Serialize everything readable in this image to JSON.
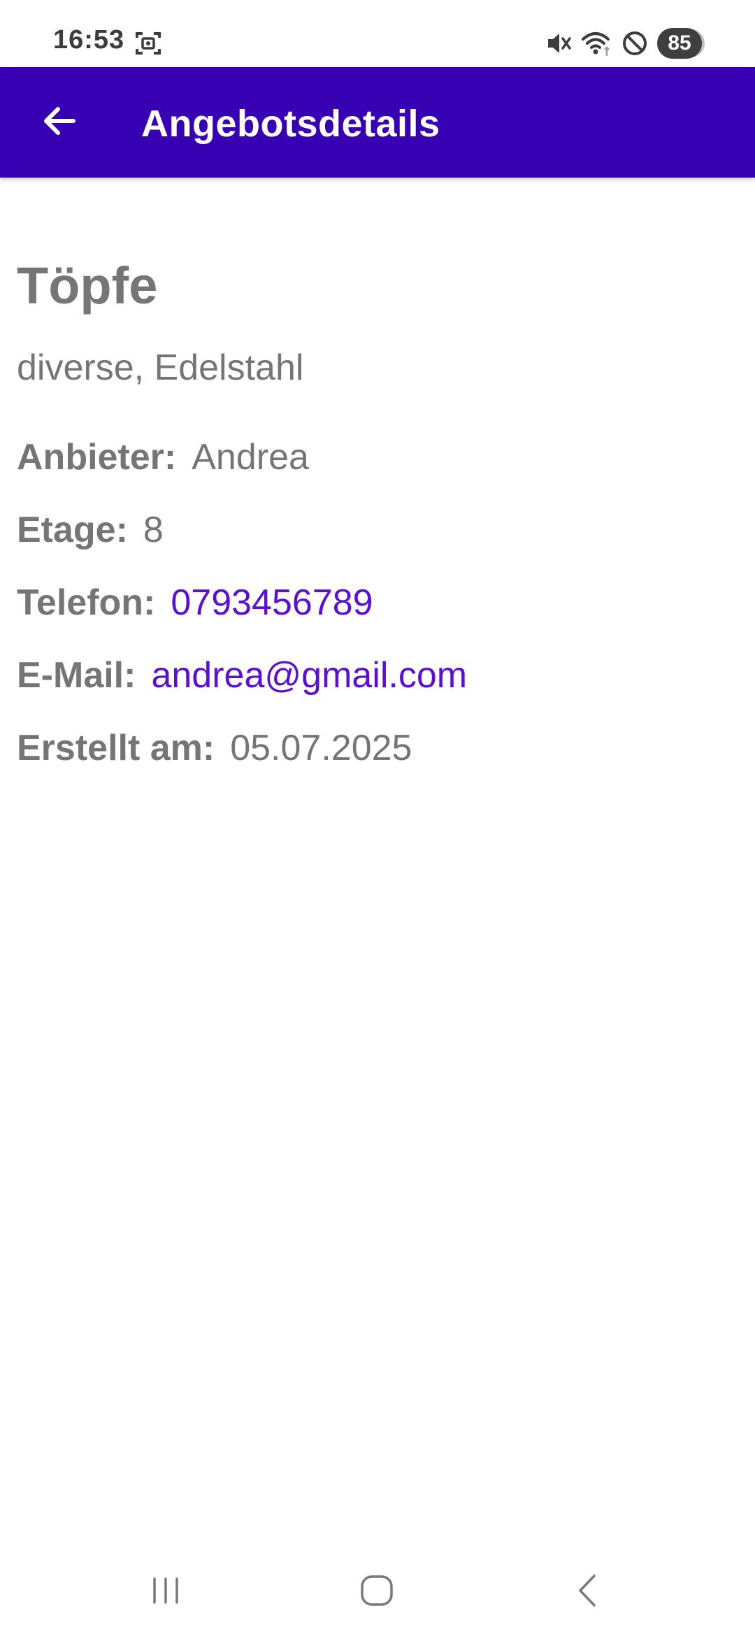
{
  "status_bar": {
    "time": "16:53",
    "battery": "85",
    "icons": [
      "screenshot-icon",
      "mute-icon",
      "wifi-icon",
      "do-not-disturb-icon",
      "battery-icon"
    ]
  },
  "app_bar": {
    "title": "Angebotsdetails",
    "back_icon": "arrow-back-icon",
    "color": "#3700b3"
  },
  "offer": {
    "title": "Töpfe",
    "description": "diverse, Edelstahl",
    "details": {
      "anbieter_label": "Anbieter:",
      "anbieter_value": "Andrea",
      "etage_label": "Etage:",
      "etage_value": "8",
      "telefon_label": "Telefon:",
      "telefon_value": "0793456789",
      "email_label": "E-Mail:",
      "email_value": "andrea@gmail.com",
      "erstellt_label": "Erstellt am:",
      "erstellt_value": "05.07.2025"
    }
  },
  "colors": {
    "text_gray": "#757575",
    "link": "#5a0fd6",
    "app_bar": "#3700b3"
  },
  "nav_bar": {
    "icons": [
      "recents-icon",
      "home-icon",
      "back-icon"
    ]
  }
}
